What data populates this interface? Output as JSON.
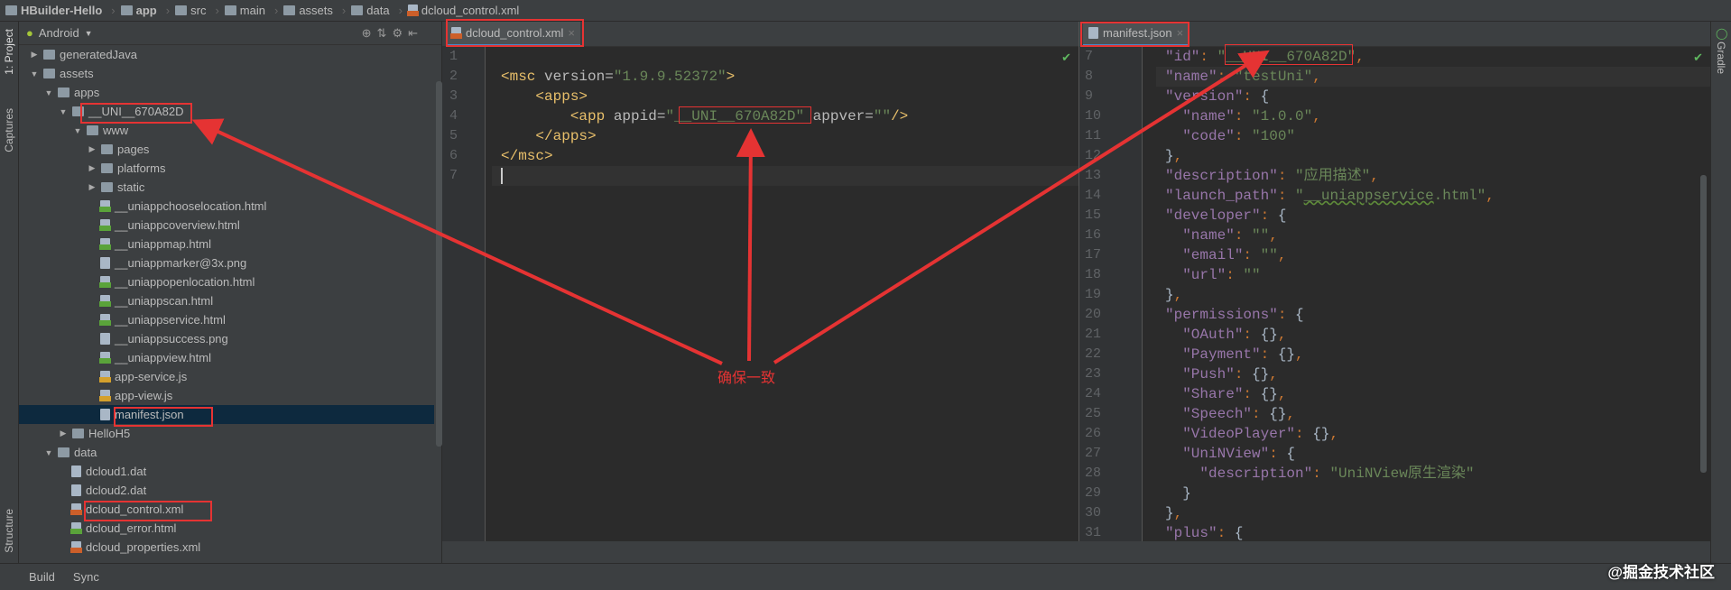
{
  "breadcrumb": [
    {
      "label": "HBuilder-Hello",
      "bold": true
    },
    {
      "label": "app",
      "bold": true
    },
    {
      "label": "src"
    },
    {
      "label": "main"
    },
    {
      "label": "assets"
    },
    {
      "label": "data"
    },
    {
      "label": "dcloud_control.xml",
      "file": "xml"
    }
  ],
  "left_strip": {
    "project": "1: Project",
    "captures": "Captures",
    "structure": "Structure"
  },
  "project_view": {
    "selector": "Android",
    "toolbar_icons": [
      "target-icon",
      "collapse-icon",
      "gear-icon",
      "hide-icon"
    ]
  },
  "tree": [
    {
      "label": "generatedJava",
      "depth": 0,
      "type": "folder",
      "expand": "closed"
    },
    {
      "label": "assets",
      "depth": 0,
      "type": "folder",
      "expand": "open"
    },
    {
      "label": "apps",
      "depth": 1,
      "type": "folder",
      "expand": "open"
    },
    {
      "label": "__UNI__670A82D",
      "depth": 2,
      "type": "folder",
      "expand": "open"
    },
    {
      "label": "www",
      "depth": 3,
      "type": "folder",
      "expand": "open"
    },
    {
      "label": "pages",
      "depth": 4,
      "type": "folder",
      "expand": "closed"
    },
    {
      "label": "platforms",
      "depth": 4,
      "type": "folder",
      "expand": "closed"
    },
    {
      "label": "static",
      "depth": 4,
      "type": "folder",
      "expand": "closed"
    },
    {
      "label": "__uniappchooselocation.html",
      "depth": 4,
      "type": "html"
    },
    {
      "label": "__uniappcoverview.html",
      "depth": 4,
      "type": "html"
    },
    {
      "label": "__uniappmap.html",
      "depth": 4,
      "type": "html"
    },
    {
      "label": "__uniappmarker@3x.png",
      "depth": 4,
      "type": "png"
    },
    {
      "label": "__uniappopenlocation.html",
      "depth": 4,
      "type": "html"
    },
    {
      "label": "__uniappscan.html",
      "depth": 4,
      "type": "html"
    },
    {
      "label": "__uniappservice.html",
      "depth": 4,
      "type": "html"
    },
    {
      "label": "__uniappsuccess.png",
      "depth": 4,
      "type": "png"
    },
    {
      "label": "__uniappview.html",
      "depth": 4,
      "type": "html"
    },
    {
      "label": "app-service.js",
      "depth": 4,
      "type": "js"
    },
    {
      "label": "app-view.js",
      "depth": 4,
      "type": "js"
    },
    {
      "label": "manifest.json",
      "depth": 4,
      "type": "json",
      "selected": true
    },
    {
      "label": "HelloH5",
      "depth": 2,
      "type": "folder",
      "expand": "closed"
    },
    {
      "label": "data",
      "depth": 1,
      "type": "folder",
      "expand": "open"
    },
    {
      "label": "dcloud1.dat",
      "depth": 2,
      "type": "dat"
    },
    {
      "label": "dcloud2.dat",
      "depth": 2,
      "type": "dat"
    },
    {
      "label": "dcloud_control.xml",
      "depth": 2,
      "type": "xml"
    },
    {
      "label": "dcloud_error.html",
      "depth": 2,
      "type": "html"
    },
    {
      "label": "dcloud_properties.xml",
      "depth": 2,
      "type": "xml"
    }
  ],
  "xml_editor": {
    "tab": "dcloud_control.xml",
    "first_line": 1,
    "current_line": 7,
    "lines": [
      [],
      [
        [
          "<msc ",
          "tag"
        ],
        [
          "version=",
          "attr"
        ],
        [
          "\"1.9.9.52372\"",
          "str"
        ],
        [
          ">",
          "tag"
        ]
      ],
      [
        [
          "    <apps>",
          "tag"
        ]
      ],
      [
        [
          "        <app ",
          "tag"
        ],
        [
          "appid=",
          "attr"
        ],
        [
          "\"__UNI__670A82D\"",
          "str"
        ],
        [
          " appver=",
          "attr"
        ],
        [
          "\"\"",
          "str"
        ],
        [
          "/>",
          "tag"
        ]
      ],
      [
        [
          "    </apps>",
          "tag"
        ]
      ],
      [
        [
          "</msc>",
          "tag"
        ]
      ],
      []
    ]
  },
  "json_editor": {
    "tab": "manifest.json",
    "first_line": 7,
    "current_line": 8,
    "lines": [
      [
        [
          "\"id\"",
          "key"
        ],
        [
          ": ",
          "p"
        ],
        [
          "\"__UNI__670A82D\"",
          "str"
        ],
        [
          ",",
          "p"
        ]
      ],
      [
        [
          "\"name\"",
          "key"
        ],
        [
          ": ",
          "p"
        ],
        [
          "\"testUni\"",
          "str"
        ],
        [
          ",",
          "p"
        ]
      ],
      [
        [
          "\"version\"",
          "key"
        ],
        [
          ": ",
          "p"
        ],
        [
          "{",
          "b"
        ]
      ],
      [
        [
          "  \"name\"",
          "key"
        ],
        [
          ": ",
          "p"
        ],
        [
          "\"1.0.0\"",
          "str"
        ],
        [
          ",",
          "p"
        ]
      ],
      [
        [
          "  \"code\"",
          "key"
        ],
        [
          ": ",
          "p"
        ],
        [
          "\"100\"",
          "str"
        ]
      ],
      [
        [
          "}",
          "b"
        ],
        [
          ",",
          "p"
        ]
      ],
      [
        [
          "\"description\"",
          "key"
        ],
        [
          ": ",
          "p"
        ],
        [
          "\"应用描述\"",
          "str"
        ],
        [
          ",",
          "p"
        ]
      ],
      [
        [
          "\"launch_path\"",
          "key"
        ],
        [
          ": ",
          "p"
        ],
        [
          "\"",
          "str"
        ],
        [
          "__uniappservice",
          "u"
        ],
        [
          ".html\"",
          "str"
        ],
        [
          ",",
          "p"
        ]
      ],
      [
        [
          "\"developer\"",
          "key"
        ],
        [
          ": ",
          "p"
        ],
        [
          "{",
          "b"
        ]
      ],
      [
        [
          "  \"name\"",
          "key"
        ],
        [
          ": ",
          "p"
        ],
        [
          "\"\"",
          "str"
        ],
        [
          ",",
          "p"
        ]
      ],
      [
        [
          "  \"email\"",
          "key"
        ],
        [
          ": ",
          "p"
        ],
        [
          "\"\"",
          "str"
        ],
        [
          ",",
          "p"
        ]
      ],
      [
        [
          "  \"url\"",
          "key"
        ],
        [
          ": ",
          "p"
        ],
        [
          "\"\"",
          "str"
        ]
      ],
      [
        [
          "}",
          "b"
        ],
        [
          ",",
          "p"
        ]
      ],
      [
        [
          "\"permissions\"",
          "key"
        ],
        [
          ": ",
          "p"
        ],
        [
          "{",
          "b"
        ]
      ],
      [
        [
          "  \"OAuth\"",
          "key"
        ],
        [
          ": ",
          "p"
        ],
        [
          "{}",
          "b"
        ],
        [
          ",",
          "p"
        ]
      ],
      [
        [
          "  \"Payment\"",
          "key"
        ],
        [
          ": ",
          "p"
        ],
        [
          "{}",
          "b"
        ],
        [
          ",",
          "p"
        ]
      ],
      [
        [
          "  \"Push\"",
          "key"
        ],
        [
          ": ",
          "p"
        ],
        [
          "{}",
          "b"
        ],
        [
          ",",
          "p"
        ]
      ],
      [
        [
          "  \"Share\"",
          "key"
        ],
        [
          ": ",
          "p"
        ],
        [
          "{}",
          "b"
        ],
        [
          ",",
          "p"
        ]
      ],
      [
        [
          "  \"Speech\"",
          "key"
        ],
        [
          ": ",
          "p"
        ],
        [
          "{}",
          "b"
        ],
        [
          ",",
          "p"
        ]
      ],
      [
        [
          "  \"VideoPlayer\"",
          "key"
        ],
        [
          ": ",
          "p"
        ],
        [
          "{}",
          "b"
        ],
        [
          ",",
          "p"
        ]
      ],
      [
        [
          "  \"UniNView\"",
          "key"
        ],
        [
          ": ",
          "p"
        ],
        [
          "{",
          "b"
        ]
      ],
      [
        [
          "    \"description\"",
          "key"
        ],
        [
          ": ",
          "p"
        ],
        [
          "\"UniNView原生渲染\"",
          "str"
        ]
      ],
      [
        [
          "  }",
          "b"
        ]
      ],
      [
        [
          "}",
          "b"
        ],
        [
          ",",
          "p"
        ]
      ],
      [
        [
          "\"plus\"",
          "key"
        ],
        [
          ": ",
          "p"
        ],
        [
          "{",
          "b"
        ]
      ]
    ]
  },
  "right_strip": {
    "gradle": "Gradle"
  },
  "bottom": {
    "build": "Build",
    "sync": "Sync"
  },
  "annotation": {
    "text": "确保一致",
    "color": "#e53333"
  },
  "watermark": "@掘金技术社区"
}
